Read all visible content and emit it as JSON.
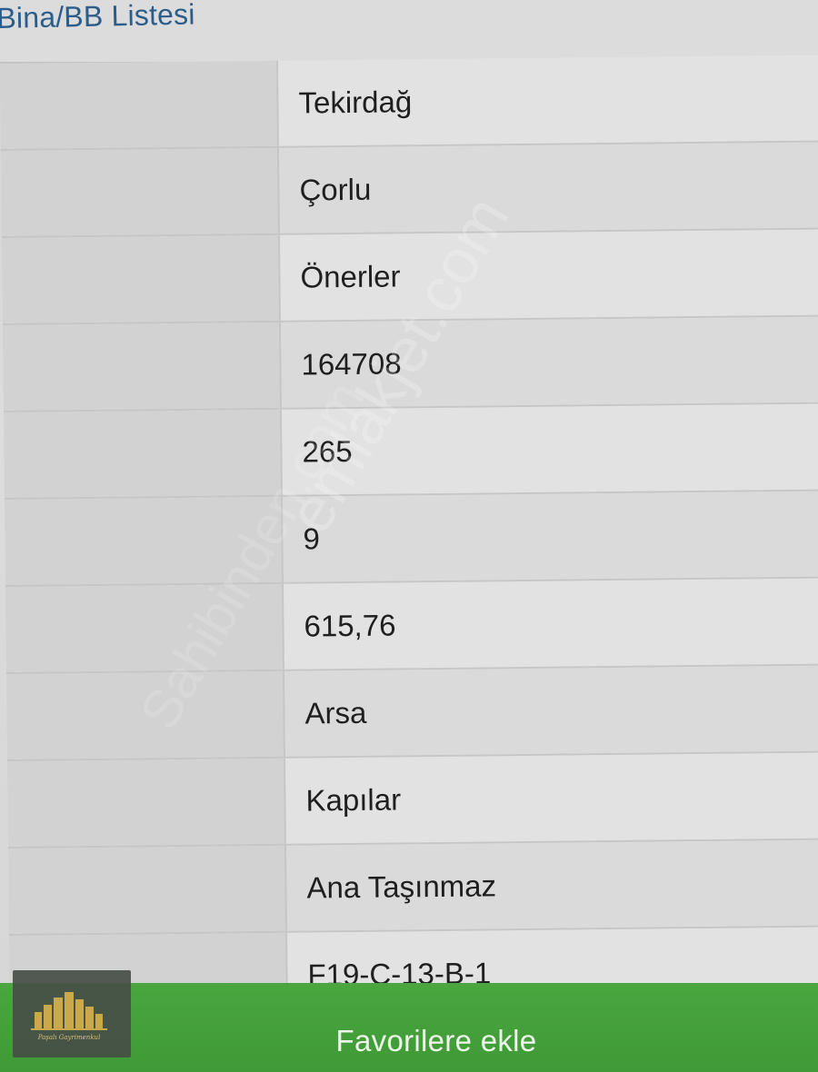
{
  "header": {
    "title": "Bina/BB Listesi"
  },
  "table": {
    "rows": [
      {
        "value": "Tekirdağ"
      },
      {
        "value": "Çorlu"
      },
      {
        "value": "Önerler"
      },
      {
        "value": "164708"
      },
      {
        "value": "265"
      },
      {
        "value": "9"
      },
      {
        "value": "615,76"
      },
      {
        "value": "Arsa"
      },
      {
        "value": "Kapılar"
      },
      {
        "value": "Ana Taşınmaz"
      },
      {
        "value": "F19-C-13-B-1"
      }
    ]
  },
  "actions": {
    "favorites_label": "Favorilere ekle"
  },
  "watermark": {
    "text": "emlakjet.com",
    "secondary": "Sahibinden.com"
  },
  "logo": {
    "text": "Paşalı Gayrimenkul"
  },
  "colors": {
    "header_title": "#2b5c8a",
    "favorites_bar": "#45a03b"
  }
}
